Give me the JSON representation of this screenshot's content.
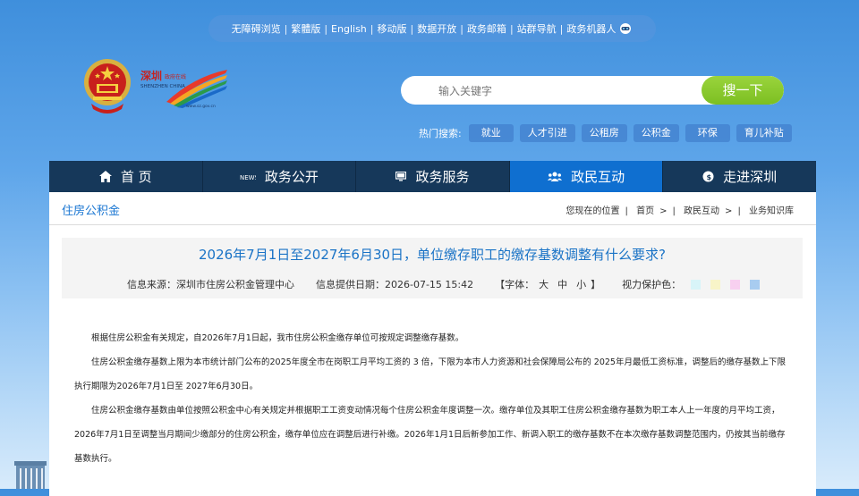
{
  "topbar": {
    "links": [
      "无障碍浏览",
      "繁體版",
      "English",
      "移动版",
      "数据开放",
      "政务邮箱",
      "站群导航",
      "政务机器人"
    ]
  },
  "search": {
    "placeholder": "输入关键字",
    "button": "搜一下"
  },
  "hot": {
    "label": "热门搜索:",
    "tags": [
      "就业",
      "人才引进",
      "公租房",
      "公积金",
      "环保",
      "育儿补贴"
    ]
  },
  "nav": {
    "items": [
      {
        "label": "首 页",
        "icon": "home-icon"
      },
      {
        "label": "政务公开",
        "icon": "news-icon"
      },
      {
        "label": "政务服务",
        "icon": "monitor-icon"
      },
      {
        "label": "政民互动",
        "icon": "people-icon"
      },
      {
        "label": "走进深圳",
        "icon": "info-icon"
      }
    ],
    "active_index": 3
  },
  "page": {
    "section_title": "住房公积金",
    "breadcrumb": {
      "prefix": "您现在的位置",
      "items": [
        "首页",
        "政民互动",
        "业务知识库"
      ]
    }
  },
  "article": {
    "title": "2026年7月1日至2027年6月30日，单位缴存职工的缴存基数调整有什么要求?",
    "source": "信息来源：深圳市住房公积金管理中心",
    "date": "信息提供日期：2026-07-15 15:42",
    "font_label": "【字体：",
    "font_sizes": [
      "大",
      "中",
      "小"
    ],
    "font_end": "】",
    "eye_label": "视力保护色：",
    "eye_colors": [
      "#d8f4f8",
      "#f8f4c8",
      "#f8d0f0",
      "#a8ccf0"
    ],
    "paragraphs": [
      "根据住房公积金有关规定，自2026年7月1日起，我市住房公积金缴存单位可按规定调整缴存基数。",
      "住房公积金缴存基数上限为本市统计部门公布的2025年度全市在岗职工月平均工资的 3 倍，下限为本市人力资源和社会保障局公布的 2025年月最低工资标准，调整后的缴存基数上下限执行期限为2026年7月1日至 2027年6月30日。",
      "住房公积金缴存基数由单位按照公积金中心有关规定并根据职工工资变动情况每个住房公积金年度调整一次。缴存单位及其职工住房公积金缴存基数为职工本人上一年度的月平均工资，2026年7月1日至调整当月期间少缴部分的住房公积金，缴存单位应在调整后进行补缴。2026年1月1日后新参加工作、新调入职工的缴存基数不在本次缴存基数调整范围内，仍按其当前缴存基数执行。"
    ]
  },
  "logo": {
    "name_cn": "深圳政府在线",
    "name_en": "SHENZHEN CHINA",
    "url": "www.sz.gov.cn"
  }
}
